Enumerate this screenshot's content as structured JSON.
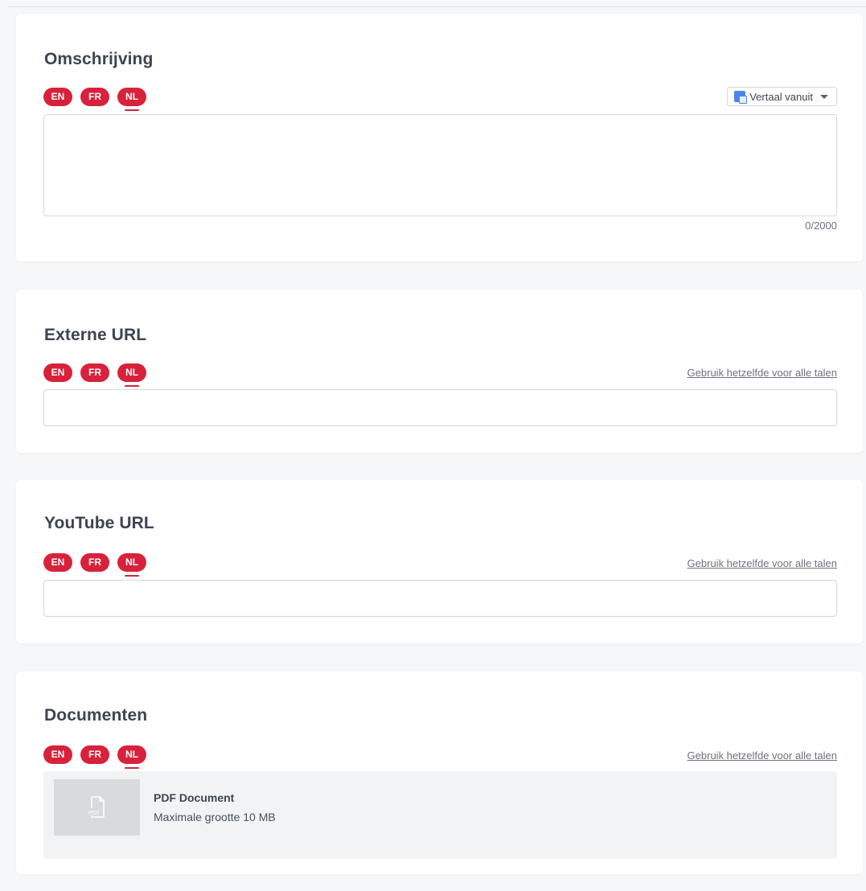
{
  "languages": [
    "EN",
    "FR",
    "NL"
  ],
  "active_language": "NL",
  "accent_color": "#d8213a",
  "description": {
    "title": "Omschrijving",
    "translate_label": "Vertaal vanuit",
    "translate_icon": "google-translate-icon",
    "value": "",
    "counter": "0/2000"
  },
  "external_url": {
    "title": "Externe URL",
    "same_for_all_label": "Gebruik hetzelfde voor alle talen",
    "value": ""
  },
  "youtube_url": {
    "title": "YouTube URL",
    "same_for_all_label": "Gebruik hetzelfde voor alle talen",
    "value": ""
  },
  "documents": {
    "title": "Documenten",
    "same_for_all_label": "Gebruik hetzelfde voor alle talen",
    "file_icon": "pdf-file-icon",
    "file_icon_label": "PDF",
    "upload_title": "PDF Document",
    "upload_subtitle": "Maximale grootte 10 MB"
  }
}
